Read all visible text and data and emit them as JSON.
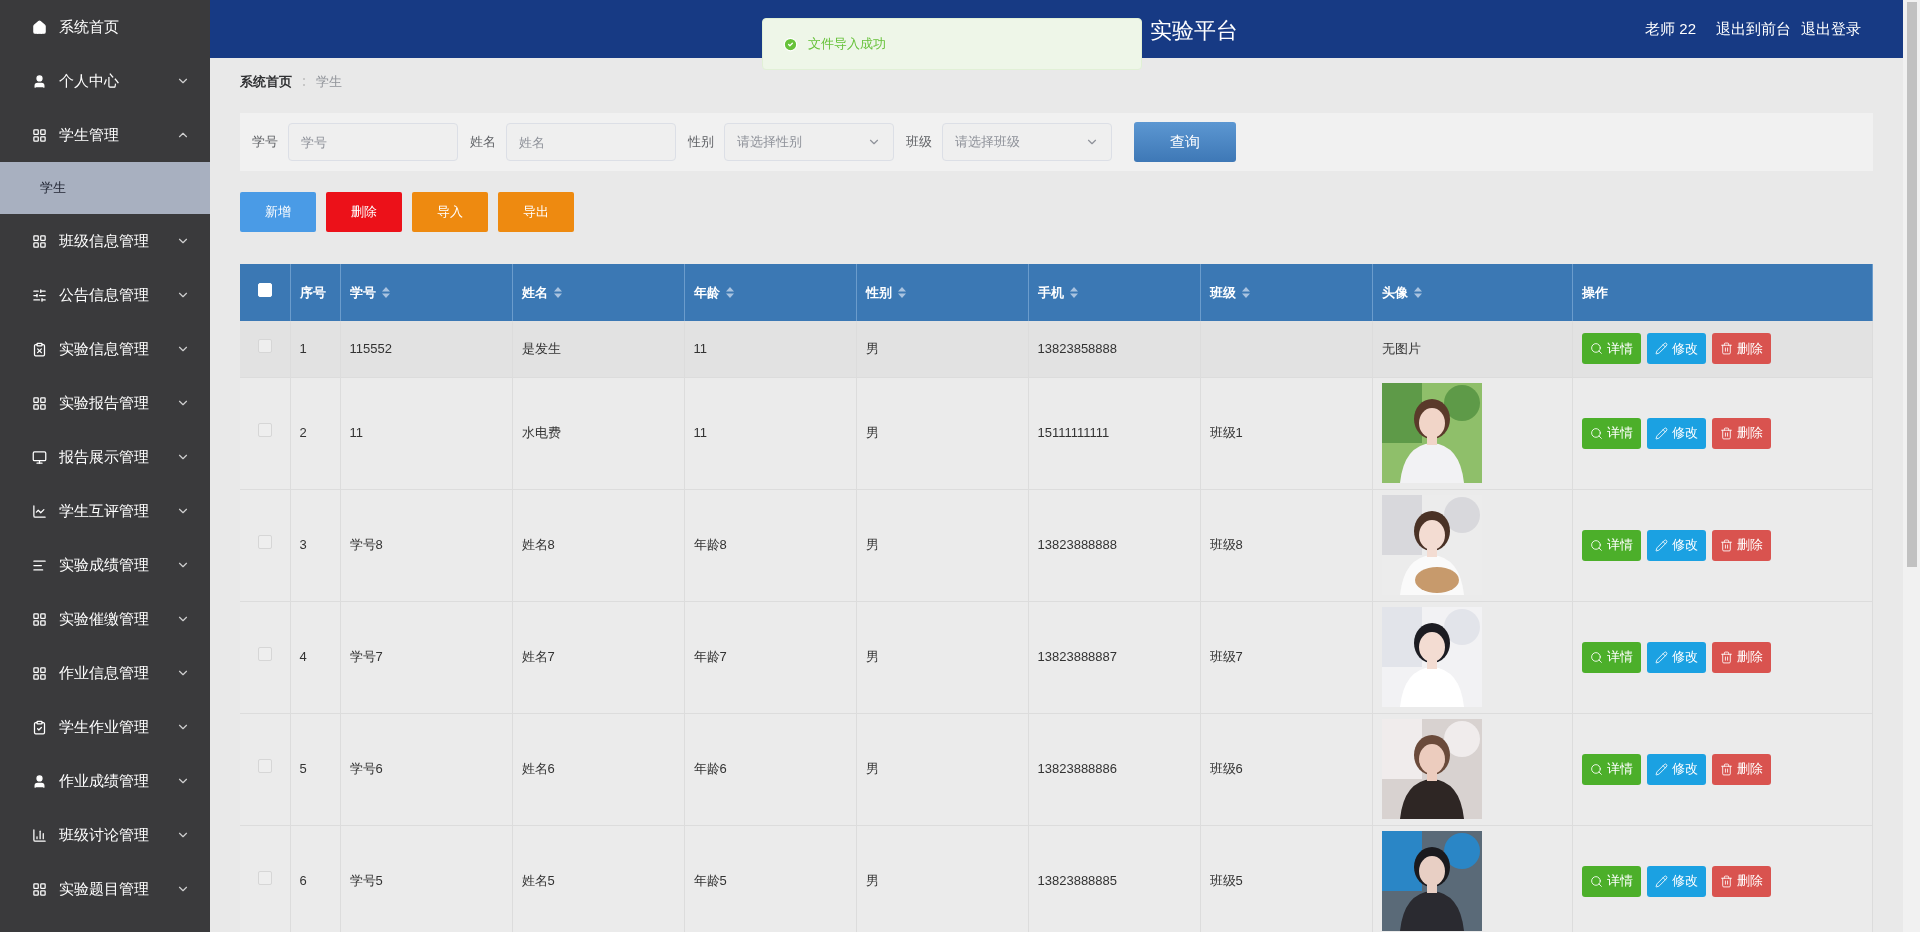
{
  "header": {
    "title": "实验平台",
    "user": "老师 22",
    "links": [
      "退出到前台",
      "退出登录"
    ]
  },
  "toast": {
    "kind": "success",
    "message": "文件导入成功"
  },
  "sidebar": {
    "items": [
      {
        "kind": "link",
        "label": "系统首页"
      },
      {
        "kind": "menu",
        "label": "个人中心",
        "expanded": false
      },
      {
        "kind": "menu",
        "label": "学生管理",
        "expanded": true,
        "children": [
          {
            "label": "学生",
            "selected": true
          }
        ]
      },
      {
        "kind": "menu",
        "label": "班级信息管理",
        "expanded": false
      },
      {
        "kind": "menu",
        "label": "公告信息管理",
        "expanded": false
      },
      {
        "kind": "menu",
        "label": "实验信息管理",
        "expanded": false
      },
      {
        "kind": "menu",
        "label": "实验报告管理",
        "expanded": false
      },
      {
        "kind": "menu",
        "label": "报告展示管理",
        "expanded": false
      },
      {
        "kind": "menu",
        "label": "学生互评管理",
        "expanded": false
      },
      {
        "kind": "menu",
        "label": "实验成绩管理",
        "expanded": false
      },
      {
        "kind": "menu",
        "label": "实验催缴管理",
        "expanded": false
      },
      {
        "kind": "menu",
        "label": "作业信息管理",
        "expanded": false
      },
      {
        "kind": "menu",
        "label": "学生作业管理",
        "expanded": false
      },
      {
        "kind": "menu",
        "label": "作业成绩管理",
        "expanded": false
      },
      {
        "kind": "menu",
        "label": "班级讨论管理",
        "expanded": false
      },
      {
        "kind": "menu",
        "label": "实验题目管理",
        "expanded": false
      }
    ]
  },
  "breadcrumb": [
    "系统首页",
    "学生"
  ],
  "search": {
    "fields": [
      {
        "kind": "input",
        "label": "学号",
        "placeholder": "学号"
      },
      {
        "kind": "input",
        "label": "姓名",
        "placeholder": "姓名"
      },
      {
        "kind": "select",
        "label": "性别",
        "placeholder": "请选择性别"
      },
      {
        "kind": "select",
        "label": "班级",
        "placeholder": "请选择班级"
      }
    ],
    "button": "查询"
  },
  "toolbar": [
    {
      "label": "新增",
      "color": "#4a9be6"
    },
    {
      "label": "删除",
      "color": "#ec1119"
    },
    {
      "label": "导入",
      "color": "#ee8a10"
    },
    {
      "label": "导出",
      "color": "#ee8a10"
    }
  ],
  "table": {
    "checked": false,
    "columns": [
      {
        "label": "序号",
        "sortable": false
      },
      {
        "label": "学号",
        "sortable": true
      },
      {
        "label": "姓名",
        "sortable": true
      },
      {
        "label": "年龄",
        "sortable": true
      },
      {
        "label": "性别",
        "sortable": true
      },
      {
        "label": "手机",
        "sortable": true
      },
      {
        "label": "班级",
        "sortable": true
      },
      {
        "label": "头像",
        "sortable": true
      },
      {
        "label": "操作",
        "sortable": false
      }
    ],
    "rows": [
      {
        "checked": false,
        "cells": [
          "1",
          "115552",
          "是发生",
          "11",
          "男",
          "13823858888"
        ],
        "avatar_text": "无图片",
        "actions": [
          {
            "kind": "view",
            "label": "详情"
          },
          {
            "kind": "edit",
            "label": "修改"
          },
          {
            "kind": "delete",
            "label": "删除"
          }
        ]
      },
      {
        "checked": false,
        "cells": [
          "2",
          "11",
          "水电费",
          "11",
          "男",
          "15111111111"
        ],
        "class": "班级1",
        "avatar": {
          "kind": "picture"
        },
        "actions": [
          {
            "kind": "view",
            "label": "详情"
          },
          {
            "kind": "edit",
            "label": "修改"
          },
          {
            "kind": "delete",
            "label": "删除"
          }
        ]
      },
      {
        "checked": false,
        "cells": [
          "3",
          "学号8",
          "姓名8",
          "年龄8",
          "男",
          "13823888888"
        ],
        "class": "班级8",
        "avatar": {
          "kind": "picture"
        },
        "actions": [
          {
            "kind": "view",
            "label": "详情"
          },
          {
            "kind": "edit",
            "label": "修改"
          },
          {
            "kind": "delete",
            "label": "删除"
          }
        ]
      },
      {
        "checked": false,
        "cells": [
          "4",
          "学号7",
          "姓名7",
          "年龄7",
          "男",
          "13823888887"
        ],
        "class": "班级7",
        "avatar": {
          "kind": "picture"
        },
        "actions": [
          {
            "kind": "view",
            "label": "详情"
          },
          {
            "kind": "edit",
            "label": "修改"
          },
          {
            "kind": "delete",
            "label": "删除"
          }
        ]
      },
      {
        "checked": false,
        "cells": [
          "5",
          "学号6",
          "姓名6",
          "年龄6",
          "男",
          "13823888886"
        ],
        "class": "班级6",
        "avatar": {
          "kind": "picture"
        },
        "actions": [
          {
            "kind": "view",
            "label": "详情"
          },
          {
            "kind": "edit",
            "label": "修改"
          },
          {
            "kind": "delete",
            "label": "删除"
          }
        ]
      },
      {
        "checked": false,
        "cells": [
          "6",
          "学号5",
          "姓名5",
          "年龄5",
          "男",
          "13823888885"
        ],
        "class": "班级5",
        "avatar": {
          "kind": "picture"
        },
        "actions": [
          {
            "kind": "view",
            "label": "详情"
          },
          {
            "kind": "edit",
            "label": "修改"
          },
          {
            "kind": "delete",
            "label": "删除"
          }
        ]
      }
    ]
  }
}
